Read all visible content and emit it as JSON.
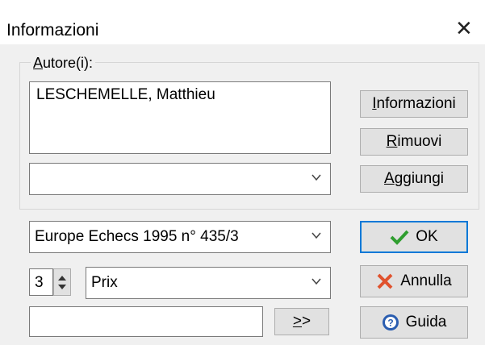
{
  "window": {
    "title": "Informazioni",
    "close_glyph": "✕"
  },
  "authors": {
    "group_label_accel": "A",
    "group_label_rest": "utore(i):",
    "list": [
      "LESCHEMELLE, Matthieu"
    ],
    "combo_value": "",
    "buttons": {
      "info": {
        "accel": "I",
        "rest": "nformazioni"
      },
      "remove": {
        "accel": "R",
        "rest": "imuovi"
      },
      "add": {
        "accel": "A",
        "rest": "ggiungi"
      }
    }
  },
  "source": {
    "value": "Europe Echecs 1995 n° 435/3"
  },
  "prize": {
    "number": "3",
    "type": "Prix"
  },
  "extra": {
    "value": "",
    "button_accel": ">",
    "button_rest": ">"
  },
  "dialog_buttons": {
    "ok": {
      "label": "OK",
      "icon": "checkmark-icon"
    },
    "cancel": {
      "label": "Annulla",
      "icon": "x-icon"
    },
    "help": {
      "label": "Guida",
      "icon": "help-icon"
    }
  },
  "colors": {
    "accent": "#0078d7",
    "ok_green": "#2f9e2f",
    "cancel_red": "#e0522d",
    "help_blue": "#2a5db0"
  }
}
